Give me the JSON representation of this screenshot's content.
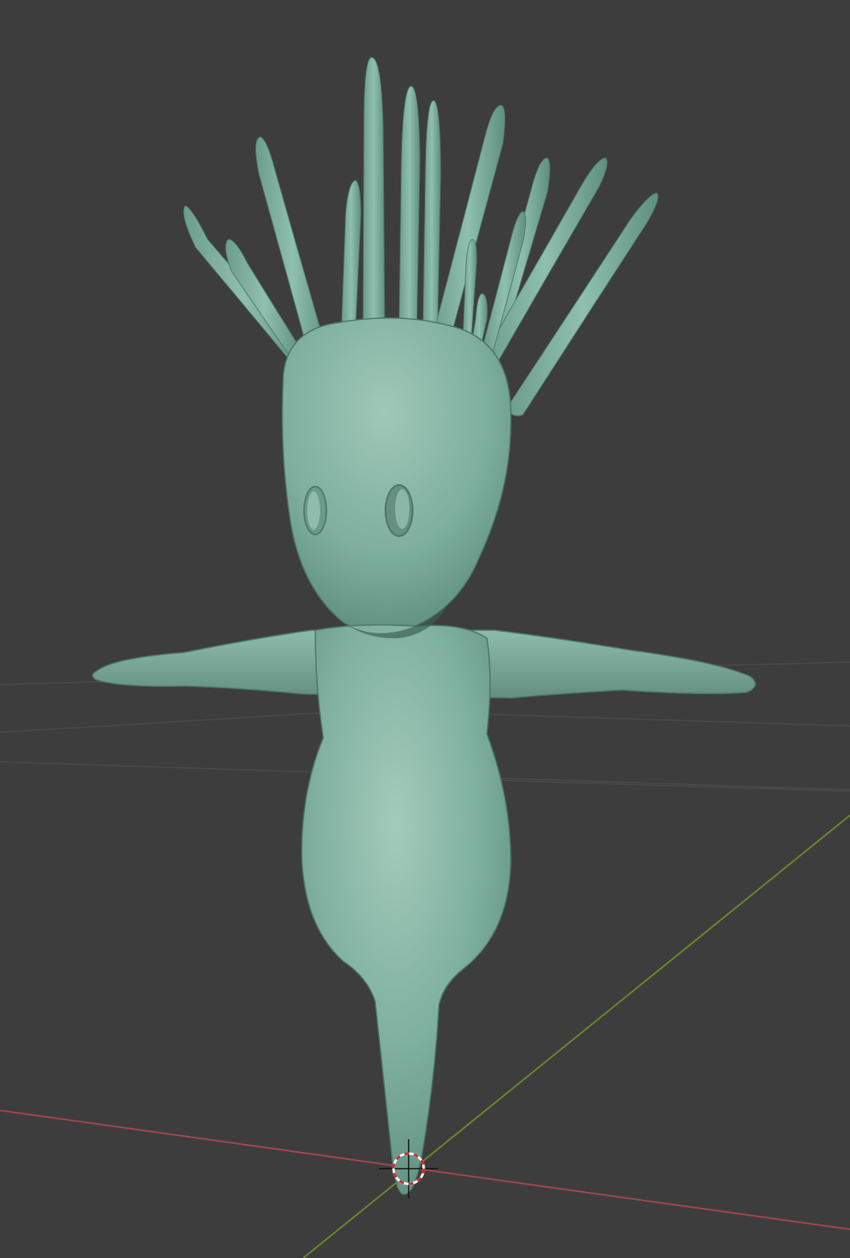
{
  "viewport": {
    "background": "#3d3d3d",
    "grid_color": "#4a4a4a",
    "x_axis_color": "#b34a55",
    "y_axis_color": "#6f8f2e",
    "mesh_color": "#7fb3a0",
    "mesh_shadow": "#5f8f7f",
    "mesh_highlight": "#a9d2c2"
  },
  "objects": {
    "model": "sculpt-mesh",
    "cursor": "3d-cursor-icon"
  }
}
